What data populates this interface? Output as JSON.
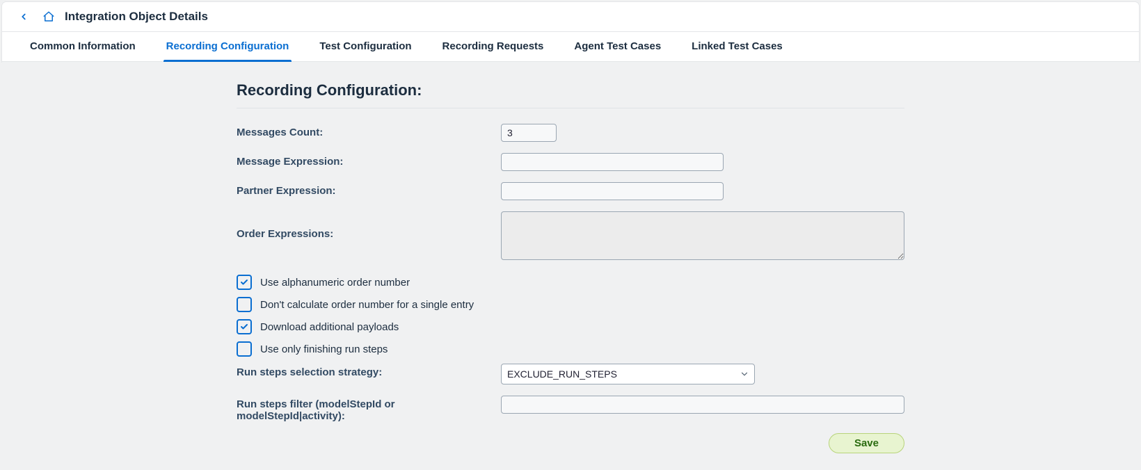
{
  "header": {
    "title": "Integration Object Details"
  },
  "tabs": [
    {
      "label": "Common Information"
    },
    {
      "label": "Recording Configuration",
      "active": true
    },
    {
      "label": "Test Configuration"
    },
    {
      "label": "Recording Requests"
    },
    {
      "label": "Agent Test Cases"
    },
    {
      "label": "Linked Test Cases"
    }
  ],
  "section_title": "Recording Configuration:",
  "fields": {
    "messages_count": {
      "label": "Messages Count:",
      "value": "3"
    },
    "message_expression": {
      "label": "Message Expression:",
      "value": ""
    },
    "partner_expression": {
      "label": "Partner Expression:",
      "value": ""
    },
    "order_expressions": {
      "label": "Order Expressions:",
      "value": ""
    },
    "run_steps_strategy": {
      "label": "Run steps selection strategy:",
      "value": "EXCLUDE_RUN_STEPS"
    },
    "run_steps_filter": {
      "label": "Run steps filter (modelStepId or modelStepId|activity):",
      "value": ""
    }
  },
  "checkboxes": {
    "use_alpha": {
      "label": "Use alphanumeric order number",
      "checked": true
    },
    "dont_calc_single": {
      "label": "Don't calculate order number for a single entry",
      "checked": false
    },
    "download_payloads": {
      "label": "Download additional payloads",
      "checked": true
    },
    "finish_only": {
      "label": "Use only finishing run steps",
      "checked": false
    }
  },
  "buttons": {
    "save": "Save"
  },
  "select_options": {
    "run_steps_strategy": [
      "EXCLUDE_RUN_STEPS"
    ]
  }
}
